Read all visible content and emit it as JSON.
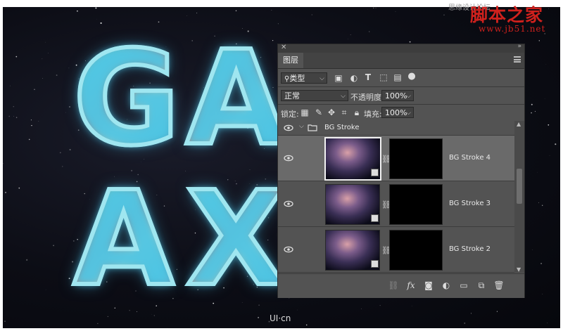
{
  "watermark": {
    "gray_text": "思缘设计论坛",
    "cn_text": "脚本之家",
    "url": "www.jb51.net",
    "bottom_text": "UI·cn"
  },
  "artwork": {
    "letters_row1": [
      "G",
      "A"
    ],
    "letters_row2": [
      "A",
      "X"
    ]
  },
  "panel": {
    "tab_label": "图层",
    "filter_kind": "类型",
    "blend_mode": "正常",
    "opacity_label": "不透明度:",
    "opacity_value": "100%",
    "lock_label": "锁定:",
    "fill_label": "填充:",
    "fill_value": "100%",
    "group": {
      "name": "BG Stroke"
    },
    "layers": [
      {
        "name": "BG Stroke 4",
        "selected": true
      },
      {
        "name": "BG Stroke 3",
        "selected": false
      },
      {
        "name": "BG Stroke 2",
        "selected": false
      }
    ],
    "scroll_position": 0.4
  },
  "colors": {
    "panel_bg": "#535353",
    "selected_row": "#6a6a6a",
    "watermark_red": "#d0211d",
    "glow": "#9fe6f0"
  }
}
